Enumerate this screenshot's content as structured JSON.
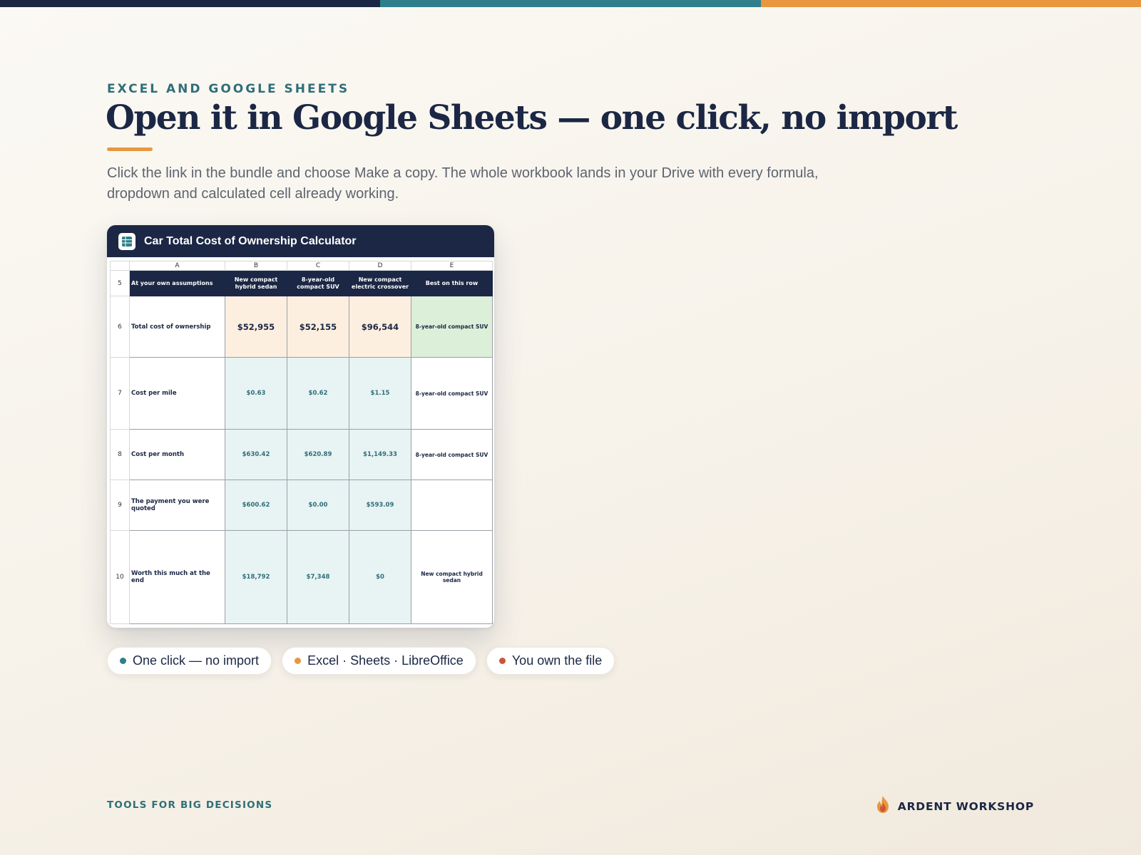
{
  "colors": {
    "navy": "#1b2744",
    "teal": "#2f7f8c",
    "orange": "#e8973f",
    "red": "#c9553a",
    "total_fill": "#fdefe0",
    "best_fill": "#dcefd8",
    "value_fill": "#e8f3f3"
  },
  "eyebrow": "EXCEL AND GOOGLE SHEETS",
  "headline": "Open it in Google Sheets — one click, no import",
  "lede": "Click the link in the bundle and choose Make a copy. The whole workbook lands in your Drive with every formula, dropdown and calculated cell already working.",
  "card": {
    "icon": "spreadsheet-icon",
    "title": "Car Total Cost of Ownership Calculator"
  },
  "sheet": {
    "columns": [
      "A",
      "B",
      "C",
      "D",
      "E"
    ],
    "header": {
      "row": "5",
      "a": "At your own assumptions",
      "b": "New compact hybrid sedan",
      "c": "8-year-old compact SUV",
      "d": "New compact electric crossover",
      "e": "Best on this row"
    },
    "rows": [
      {
        "row": "6",
        "label": "Total cost of ownership",
        "b": "$52,955",
        "c": "$52,155",
        "d": "$96,544",
        "best": "8-year-old compact SUV"
      },
      {
        "row": "7",
        "label": "Cost per mile",
        "b": "$0.63",
        "c": "$0.62",
        "d": "$1.15",
        "best": "8-year-old compact SUV"
      },
      {
        "row": "8",
        "label": "Cost per month",
        "b": "$630.42",
        "c": "$620.89",
        "d": "$1,149.33",
        "best": "8-year-old compact SUV"
      },
      {
        "row": "9",
        "label": "The payment you were quoted",
        "b": "$600.62",
        "c": "$0.00",
        "d": "$593.09",
        "best": ""
      },
      {
        "row": "10",
        "label": "Worth this much at the end",
        "b": "$18,792",
        "c": "$7,348",
        "d": "$0",
        "best": "New compact hybrid sedan"
      }
    ]
  },
  "pills": [
    {
      "label": "One click — no import",
      "dot_color": "#2f7f8c"
    },
    {
      "label": "Excel · Sheets · LibreOffice",
      "dot_color": "#e8973f"
    },
    {
      "label": "You own the file",
      "dot_color": "#c9553a"
    }
  ],
  "footer": {
    "tagline": "TOOLS FOR BIG DECISIONS",
    "brand": "ARDENT WORKSHOP",
    "brand_icon": "flame-logo-icon"
  }
}
